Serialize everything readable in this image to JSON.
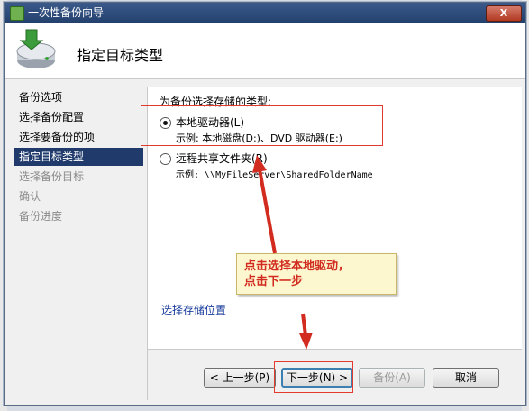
{
  "window": {
    "title": "一次性备份向导",
    "close_label": "X"
  },
  "header": {
    "title": "指定目标类型"
  },
  "steps": [
    {
      "label": "备份选项",
      "state": "normal"
    },
    {
      "label": "选择备份配置",
      "state": "normal"
    },
    {
      "label": "选择要备份的项",
      "state": "normal"
    },
    {
      "label": "指定目标类型",
      "state": "active"
    },
    {
      "label": "选择备份目标",
      "state": "disabled"
    },
    {
      "label": "确认",
      "state": "disabled"
    },
    {
      "label": "备份进度",
      "state": "disabled"
    }
  ],
  "content": {
    "prompt": "为备份选择存储的类型:",
    "options": [
      {
        "label": "本地驱动器(L)",
        "example": "示例: 本地磁盘(D:)、DVD 驱动器(E:)",
        "checked": true
      },
      {
        "label": "远程共享文件夹(R)",
        "example": "示例: \\\\MyFileServer\\SharedFolderName",
        "checked": false
      }
    ],
    "link": "选择存储位置"
  },
  "buttons": {
    "prev": "< 上一步(P)",
    "next": "下一步(N) >",
    "backup": "备份(A)",
    "cancel": "取消"
  },
  "annotation": {
    "callout": "点击选择本地驱动，\n点击下一步",
    "color": "#e23b2e"
  },
  "icons": {
    "title": "backup-wizard-icon",
    "header": "backup-disk-arrow-icon"
  }
}
